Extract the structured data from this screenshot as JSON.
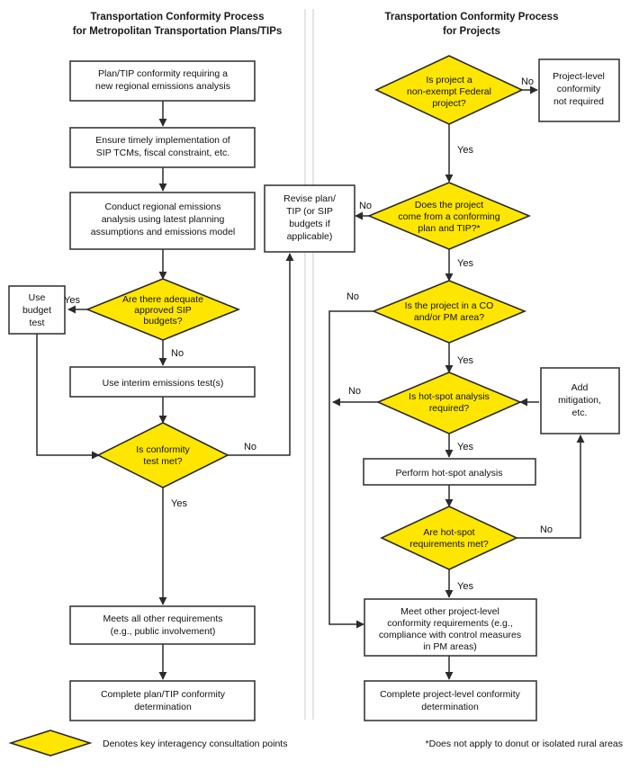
{
  "diagram": {
    "title_left_line1": "Transportation Conformity Process",
    "title_left_line2": "for Metropolitan Transportation Plans/TIPs",
    "title_right_line1": "Transportation Conformity Process",
    "title_right_line2": "for Projects",
    "accent_color": "#FFE600",
    "box_fill": "#FFFFFF",
    "stroke_color": "#2B2B2B",
    "divider_color": "#D9D9D9"
  },
  "left_column": {
    "n1": {
      "kind": "process",
      "lines": [
        "Plan/TIP conformity requiring a",
        "new regional emissions analysis"
      ]
    },
    "n2": {
      "kind": "process",
      "lines": [
        "Ensure timely implementation of",
        "SIP TCMs, fiscal constraint, etc."
      ]
    },
    "n3": {
      "kind": "process",
      "lines": [
        "Conduct regional emissions",
        "analysis using latest planning",
        "assumptions and emissions model"
      ]
    },
    "n4": {
      "kind": "decision",
      "lines": [
        "Are there adequate",
        "approved SIP",
        "budgets?"
      ]
    },
    "n5": {
      "kind": "process",
      "lines": [
        "Use",
        "budget",
        "test"
      ]
    },
    "n6": {
      "kind": "process",
      "lines": [
        "Use interim emissions test(s)"
      ]
    },
    "n7": {
      "kind": "decision",
      "lines": [
        "Is conformity",
        "test met?"
      ]
    },
    "n8": {
      "kind": "process",
      "lines": [
        "Meets all other requirements",
        "(e.g., public involvement)"
      ]
    },
    "n9": {
      "kind": "process",
      "lines": [
        "Complete plan/TIP conformity",
        "determination"
      ]
    }
  },
  "shared": {
    "revise": {
      "kind": "process",
      "lines": [
        "Revise plan/",
        "TIP (or SIP",
        "budgets if",
        "applicable)"
      ]
    }
  },
  "right_column": {
    "r1": {
      "kind": "decision",
      "lines": [
        "Is project a",
        "non-exempt Federal",
        "project?"
      ]
    },
    "r2": {
      "kind": "process",
      "lines": [
        "Project-level",
        "conformity",
        "not required"
      ]
    },
    "r3": {
      "kind": "decision",
      "lines": [
        "Does the project",
        "come from a conforming",
        "plan and TIP?*"
      ]
    },
    "r4": {
      "kind": "decision",
      "lines": [
        "Is the project in a CO",
        "and/or PM area?"
      ]
    },
    "r5": {
      "kind": "decision",
      "lines": [
        "Is hot-spot analysis",
        "required?"
      ]
    },
    "r6": {
      "kind": "process",
      "lines": [
        "Add",
        "mitigation,",
        "etc."
      ]
    },
    "r7": {
      "kind": "process",
      "lines": [
        "Perform hot-spot analysis"
      ]
    },
    "r8": {
      "kind": "decision",
      "lines": [
        "Are hot-spot",
        "requirements met?"
      ]
    },
    "r9": {
      "kind": "process",
      "lines": [
        "Meet other project-level",
        "conformity requirements (e.g.,",
        "compliance with control measures",
        "in PM areas)"
      ]
    },
    "r10": {
      "kind": "process",
      "lines": [
        "Complete project-level conformity",
        "determination"
      ]
    }
  },
  "edge_labels": {
    "l_yes_budget": "Yes",
    "l_no_budget": "No",
    "l_yes_conformity": "Yes",
    "l_no_conformity": "No",
    "r_no_federal": "No",
    "r_yes_federal": "Yes",
    "r_no_conforming": "No",
    "r_yes_conforming": "Yes",
    "r_no_copm": "No",
    "r_yes_copm": "Yes",
    "r_no_hotspot": "No",
    "r_yes_hotspot": "Yes",
    "r_no_hsreq": "No",
    "r_yes_hsreq": "Yes"
  },
  "legend": {
    "text": "Denotes key interagency consultation points",
    "swatch_color": "#FFE600"
  },
  "footnote": {
    "text": "*Does not apply to donut or isolated rural areas"
  }
}
